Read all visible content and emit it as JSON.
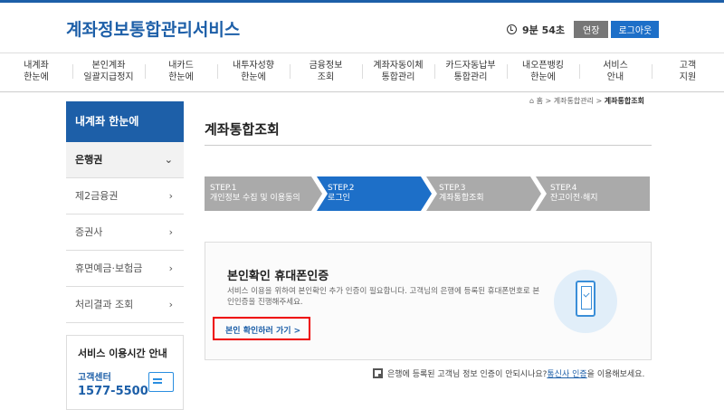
{
  "header": {
    "logo": "계좌정보통합관리서비스",
    "timer": "9분 54초",
    "extend_label": "연장",
    "logout_label": "로그아웃"
  },
  "gnb": [
    {
      "label": "내계좌\n한눈에"
    },
    {
      "label": "본인계좌\n일괄지급정지"
    },
    {
      "label": "내카드\n한눈에"
    },
    {
      "label": "내투자성향\n한눈에"
    },
    {
      "label": "금융정보\n조회"
    },
    {
      "label": "계좌자동이체\n통합관리"
    },
    {
      "label": "카드자동납부\n통합관리"
    },
    {
      "label": "내오픈뱅킹\n한눈에"
    },
    {
      "label": "서비스\n안내"
    },
    {
      "label": "고객\n지원"
    }
  ],
  "sidebar": {
    "title": "내계좌 한눈에",
    "items": [
      {
        "label": "은행권",
        "arrow": "⌄"
      },
      {
        "label": "제2금융권",
        "arrow": "›"
      },
      {
        "label": "증권사",
        "arrow": "›"
      },
      {
        "label": "휴면예금·보험금",
        "arrow": "›"
      },
      {
        "label": "처리결과 조회",
        "arrow": "›"
      }
    ],
    "service": {
      "title": "서비스 이용시간 안내",
      "center": "고객센터",
      "phone": "1577-5500"
    }
  },
  "breadcrumb": {
    "home": "홈",
    "sep1": ">",
    "parent": "계좌통합관리",
    "sep2": ">",
    "current": "계좌통합조회"
  },
  "page": {
    "title": "계좌통합조회"
  },
  "steps": [
    {
      "num": "STEP.1",
      "label": "개인정보 수집 및 이용동의"
    },
    {
      "num": "STEP.2",
      "label": "로그인"
    },
    {
      "num": "STEP.3",
      "label": "계좌통합조회"
    },
    {
      "num": "STEP.4",
      "label": "잔고이전·해지"
    }
  ],
  "auth": {
    "title": "본인확인 휴대폰인증",
    "desc": "서비스 이용을 위하여 본인확인 추가 인증이 필요합니다. 고객님의 은행에 등록된 휴대폰번호로 본인인증을 진행해주세요.",
    "link": "본인 확인하러 가기 >"
  },
  "note": {
    "before": "은행에 등록된 고객님 정보 인증이 안되시나요? ",
    "link": "통신사 인증",
    "after": "을 이용해보세요."
  },
  "colors": {
    "primary": "#1d5fa8",
    "step_active": "#1d6fc8",
    "step_inactive": "#aaaaaa",
    "highlight": "#ee0000"
  }
}
